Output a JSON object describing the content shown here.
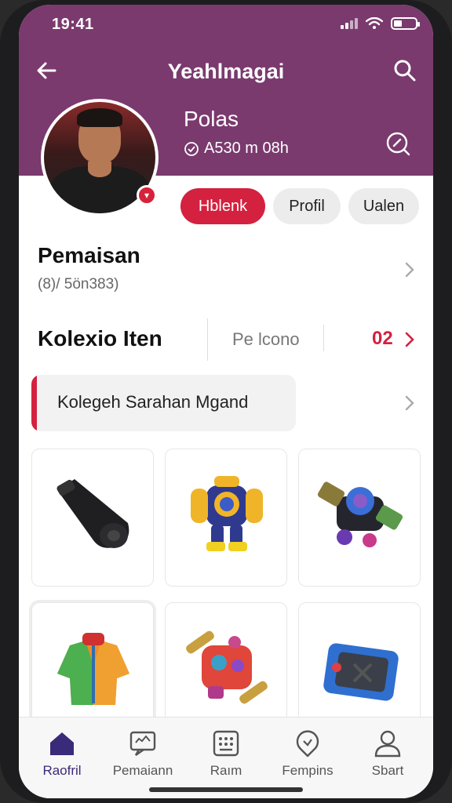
{
  "status": {
    "time": "19:41"
  },
  "header": {
    "title": "Yeahlmagai"
  },
  "profile": {
    "name": "Polas",
    "subtitle": "A530 m 08h"
  },
  "tabs": [
    {
      "label": "Hblenk",
      "active": true
    },
    {
      "label": "Profil",
      "active": false
    },
    {
      "label": "Ualen",
      "active": false
    }
  ],
  "section_pemaisan": {
    "title": "Pemaisan",
    "subtitle": "(8)/ 5ön383)"
  },
  "collection": {
    "title": "Kolexio Iten",
    "middle": "Pe lcono",
    "count": "02"
  },
  "banner": {
    "text": "Kolegeh Sarahan Mgand"
  },
  "items": [
    {
      "icon": "black-horn-item-icon"
    },
    {
      "icon": "armor-robot-item-icon"
    },
    {
      "icon": "mech-cannon-item-icon"
    },
    {
      "icon": "jacket-item-icon"
    },
    {
      "icon": "red-machine-item-icon"
    },
    {
      "icon": "blue-device-item-icon"
    }
  ],
  "nav": [
    {
      "label": "Raofril",
      "icon": "home-icon",
      "active": true
    },
    {
      "label": "Pemaiann",
      "icon": "chat-icon",
      "active": false
    },
    {
      "label": "Raım",
      "icon": "grid-box-icon",
      "active": false
    },
    {
      "label": "Fempins",
      "icon": "pin-icon",
      "active": false
    },
    {
      "label": "Sbart",
      "icon": "person-icon",
      "active": false
    }
  ],
  "colors": {
    "header": "#7a3a6e",
    "accent": "#d3213f",
    "nav_active": "#3a2a7a"
  }
}
